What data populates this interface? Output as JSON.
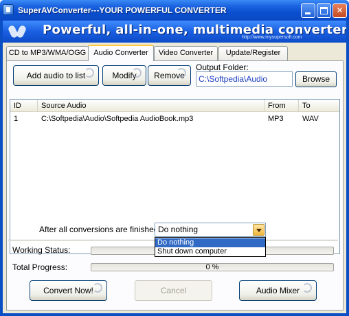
{
  "window": {
    "title": "SuperAVConverter---YOUR POWERFUL CONVERTER",
    "icon": "app-icon"
  },
  "banner": {
    "headline": "Powerful, all-in-one, multimedia converter!",
    "url": "http://www.mysupersoft.com"
  },
  "tabs": [
    {
      "label": "CD to MP3/WMA/OGG",
      "active": false
    },
    {
      "label": "Audio Converter",
      "active": true
    },
    {
      "label": "Video Converter",
      "active": false
    },
    {
      "label": "Update/Register",
      "active": false
    }
  ],
  "toolbar": {
    "add_label": "Add audio to list",
    "modify_label": "Modify",
    "remove_label": "Remove",
    "output_folder_label": "Output Folder:",
    "output_folder_value": "C:\\Softpedia\\Audio",
    "browse_label": "Browse"
  },
  "table": {
    "columns": [
      "ID",
      "Source Audio",
      "From",
      "To"
    ],
    "rows": [
      [
        "1",
        "C:\\Softpedia\\Audio\\Softpedia AudioBook.mp3",
        "MP3",
        "WAV"
      ]
    ]
  },
  "after_conversion": {
    "label": "After all conversions are finished:",
    "selected": "Do nothing",
    "options": [
      "Do nothing",
      "Shut down computer"
    ]
  },
  "status": {
    "working_label": "Working Status:",
    "working_progress": 0,
    "total_label": "Total Progress:",
    "total_progress_text": "0 %",
    "total_progress": 0
  },
  "actions": {
    "convert_label": "Convert Now!",
    "cancel_label": "Cancel",
    "mixer_label": "Audio Mixer"
  },
  "colors": {
    "accent": "#0b4fc4",
    "selection": "#316ac5",
    "path_text": "#1a3cc0"
  }
}
